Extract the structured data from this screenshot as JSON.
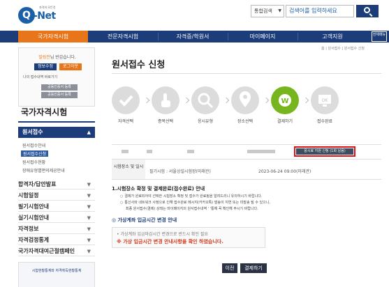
{
  "header": {
    "logo_tag": "자격의 모든것",
    "logo_q": "Q",
    "logo_net": "-Net",
    "search_category": "통합검색",
    "search_placeholder": "검색어를 입력하세요"
  },
  "gnb": {
    "items": [
      "국가자격시험",
      "전문자격시험",
      "자격증/학원서",
      "마이페이지",
      "고객지원"
    ],
    "all_menu": "전체메뉴"
  },
  "login": {
    "welcome_name": "빌링전",
    "welcome_suffix": "님 반갑습니다.",
    "info_edit": "정보수정",
    "logout": "로그아웃",
    "recent_link": "나의 접수내역 바로가기",
    "cert_register": "공동인증서 등록",
    "cert_login": "공동인증서 등록"
  },
  "sidebar": {
    "title": "국가자격시험",
    "active_menu": "원서접수",
    "sub_items": [
      "원서접수안내",
      "원서접수신청",
      "원서접수현황",
      "장애유형별편의제공안내"
    ],
    "categories": [
      "합격자/답안발표",
      "시험일정",
      "필기시험안내",
      "실기시험안내",
      "자격정보",
      "자격검정통계",
      "국가자격대여근절캠페인"
    ],
    "banner": "시험현황통계와 자격취득현황통계"
  },
  "main": {
    "breadcrumb": "홈 | 원서접수 | 원서접수 신청",
    "title": "원서접수 신청",
    "steps": [
      "자격선택",
      "종목선택",
      "응시유형",
      "장소선택",
      "결제하기",
      "접수완료"
    ],
    "active_step": 4,
    "apply_button": "응시료 지원 신청 (1회 남음)",
    "exam_header": "시험장소 및 일시",
    "exam_place": "필기시험 : 서울상설시험장(미래관)",
    "exam_date": "2023-06-24 09:00(미래관)",
    "notice_title": "1.시험장소 확정 및 결제완료(접수완료) 안내",
    "notice_line1": "결제가 완료되어야 선택한 시험장소 확정 및 접수가 완료됨을 알려드리니 유의하시기 바랍니다.",
    "notice_line2": "통신사와 네트워크 사정으로 인해 접수완료 메시지(카카오톡) 발송이 지연 또는 미발송 될 수 있으니,",
    "notice_line3": "최종 원서접수(결제) 상태는 마이페이지의 원서접수내역 '   '통해 꼭 확인해 주시기 바랍니다.",
    "section_title": "가상계좌 입금시간 변경 안내",
    "box_line1": "가상계좌 입금마감시간 변경으로 반드시 확인 필요",
    "box_line2": "※ 가상 입금시간 변경 안내사항을 확인 하였습니다.",
    "prev_button": "이전",
    "pay_button": "결제하기"
  }
}
